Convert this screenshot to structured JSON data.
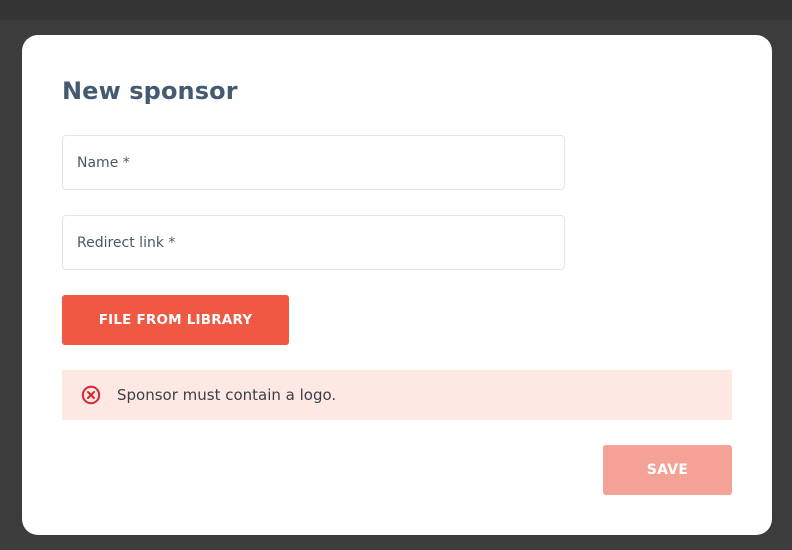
{
  "dialog": {
    "title": "New sponsor"
  },
  "fields": {
    "name": {
      "placeholder": "Name *",
      "value": ""
    },
    "redirect_link": {
      "placeholder": "Redirect link *",
      "value": ""
    }
  },
  "buttons": {
    "file_from_library": "FILE FROM LIBRARY",
    "save": "SAVE"
  },
  "alert": {
    "message": "Sponsor must contain a logo.",
    "icon": "error-circle-x-icon"
  },
  "colors": {
    "primary": "#ef5944",
    "primary_disabled": "#f4a196",
    "title": "#445a72",
    "alert_background": "#fde8e4",
    "alert_icon": "#d9252b"
  }
}
